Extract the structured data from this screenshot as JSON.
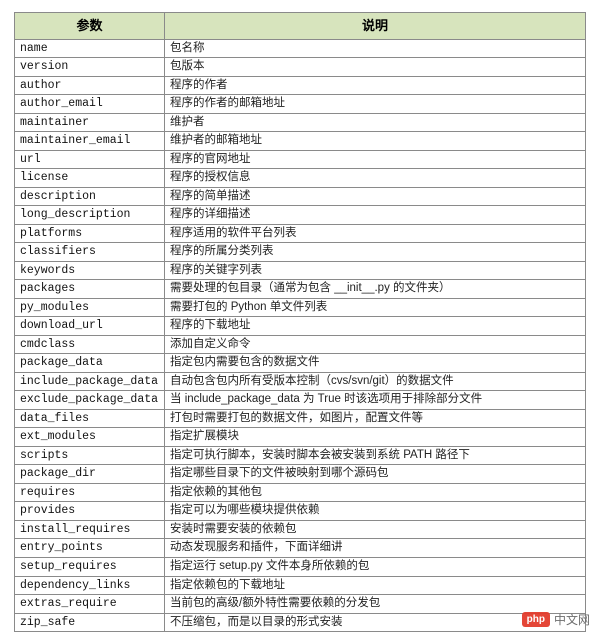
{
  "table": {
    "headers": {
      "param": "参数",
      "desc": "说明"
    },
    "rows": [
      {
        "param": "name",
        "desc": "包名称"
      },
      {
        "param": "version",
        "desc": "包版本"
      },
      {
        "param": "author",
        "desc": "程序的作者"
      },
      {
        "param": "author_email",
        "desc": "程序的作者的邮箱地址"
      },
      {
        "param": "maintainer",
        "desc": "维护者"
      },
      {
        "param": "maintainer_email",
        "desc": "维护者的邮箱地址"
      },
      {
        "param": "url",
        "desc": "程序的官网地址"
      },
      {
        "param": "license",
        "desc": "程序的授权信息"
      },
      {
        "param": "description",
        "desc": "程序的简单描述"
      },
      {
        "param": "long_description",
        "desc": "程序的详细描述"
      },
      {
        "param": "platforms",
        "desc": "程序适用的软件平台列表"
      },
      {
        "param": "classifiers",
        "desc": "程序的所属分类列表"
      },
      {
        "param": "keywords",
        "desc": "程序的关键字列表"
      },
      {
        "param": "packages",
        "desc": "需要处理的包目录（通常为包含 __init__.py 的文件夹）"
      },
      {
        "param": "py_modules",
        "desc": "需要打包的 Python 单文件列表"
      },
      {
        "param": "download_url",
        "desc": "程序的下载地址"
      },
      {
        "param": "cmdclass",
        "desc": "添加自定义命令"
      },
      {
        "param": "package_data",
        "desc": "指定包内需要包含的数据文件"
      },
      {
        "param": "include_package_data",
        "desc": "自动包含包内所有受版本控制（cvs/svn/git）的数据文件"
      },
      {
        "param": "exclude_package_data",
        "desc": "当 include_package_data 为 True 时该选项用于排除部分文件"
      },
      {
        "param": "data_files",
        "desc": "打包时需要打包的数据文件，如图片，配置文件等"
      },
      {
        "param": "ext_modules",
        "desc": "指定扩展模块"
      },
      {
        "param": "scripts",
        "desc": "指定可执行脚本，安装时脚本会被安装到系统 PATH 路径下"
      },
      {
        "param": "package_dir",
        "desc": "指定哪些目录下的文件被映射到哪个源码包"
      },
      {
        "param": "requires",
        "desc": "指定依赖的其他包"
      },
      {
        "param": "provides",
        "desc": "指定可以为哪些模块提供依赖"
      },
      {
        "param": "install_requires",
        "desc": "安装时需要安装的依赖包"
      },
      {
        "param": "entry_points",
        "desc": "动态发现服务和插件，下面详细讲"
      },
      {
        "param": "setup_requires",
        "desc": "指定运行 setup.py 文件本身所依赖的包"
      },
      {
        "param": "dependency_links",
        "desc": "指定依赖包的下载地址"
      },
      {
        "param": "extras_require",
        "desc": "当前包的高级/额外特性需要依赖的分发包"
      },
      {
        "param": "zip_safe",
        "desc": "不压缩包，而是以目录的形式安装"
      }
    ]
  },
  "watermark": {
    "badge": "php",
    "text": "中文网"
  }
}
